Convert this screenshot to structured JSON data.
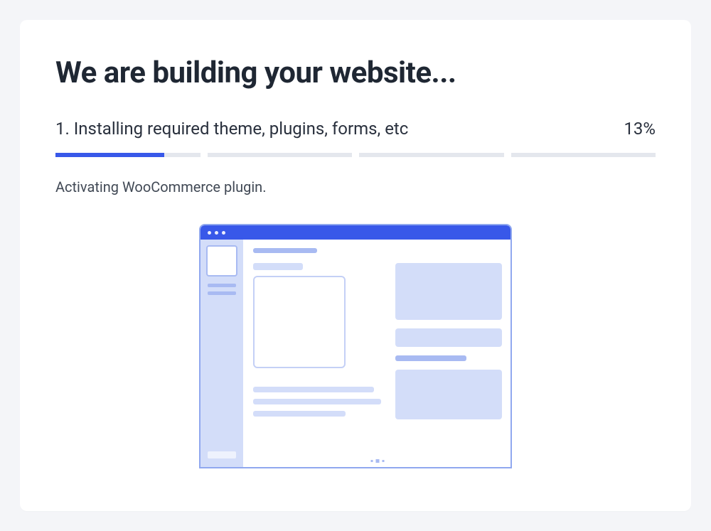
{
  "title": "We are building your website...",
  "step": {
    "label": "1. Installing required theme, plugins, forms, etc",
    "percent_text": "13%",
    "percent_value": 13,
    "segments": 4,
    "segment_fill_first": 75
  },
  "status": "Activating WooCommerce plugin.",
  "colors": {
    "accent": "#3858e9",
    "track": "#e4e7ed",
    "text_dark": "#1f2733"
  }
}
